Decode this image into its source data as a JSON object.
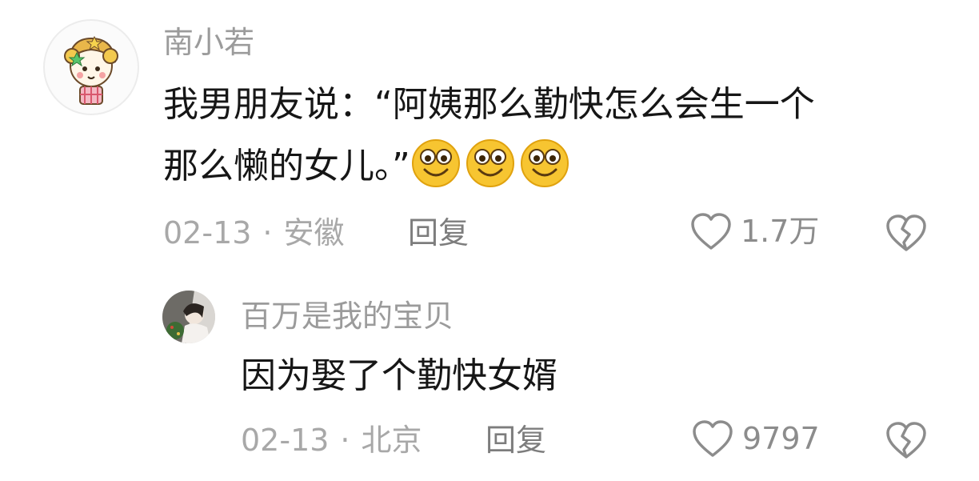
{
  "comments": [
    {
      "username": "南小若",
      "text_line1": "我男朋友说：“阿姨那么勤快怎么会生一个",
      "text_line2": "那么懒的女儿。”",
      "emoji_icon": "smiling-face-emoji",
      "emoji_count": 3,
      "date": "02-13",
      "separator": "·",
      "location": "安徽",
      "reply_label": "回复",
      "like_count": "1.7万"
    },
    {
      "username": "百万是我的宝贝",
      "text": "因为娶了个勤快女婿",
      "date": "02-13",
      "separator": "·",
      "location": "北京",
      "reply_label": "回复",
      "like_count": "9797"
    }
  ],
  "icons": {
    "like": "heart-outline-icon",
    "dislike": "broken-heart-icon"
  },
  "colors": {
    "username": "#9b9b9b",
    "content": "#161616",
    "meta": "#a8a8a8",
    "icon": "#8c8c8c"
  }
}
